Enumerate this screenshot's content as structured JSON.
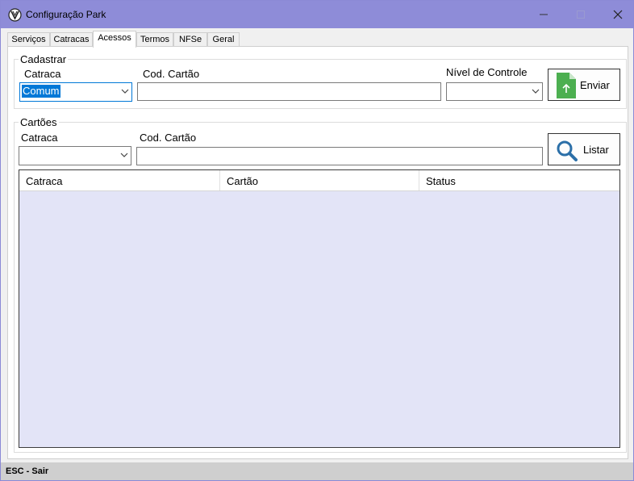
{
  "window": {
    "title": "Configuração Park"
  },
  "tabs": [
    {
      "label": "Serviços"
    },
    {
      "label": "Catracas"
    },
    {
      "label": "Acessos"
    },
    {
      "label": "Termos"
    },
    {
      "label": "NFSe"
    },
    {
      "label": "Geral"
    }
  ],
  "active_tab": "Acessos",
  "cadastrar": {
    "legend": "Cadastrar",
    "catraca_label": "Catraca",
    "catraca_value": "Comum",
    "cod_cartao_label": "Cod. Cartão",
    "cod_cartao_value": "",
    "nivel_label": "Nível de Controle",
    "nivel_value": "",
    "send_button": "Enviar"
  },
  "cartoes": {
    "legend": "Cartões",
    "catraca_label": "Catraca",
    "catraca_value": "",
    "cod_cartao_label": "Cod. Cartão",
    "cod_cartao_value": "",
    "list_button": "Listar"
  },
  "grid": {
    "columns": [
      "Catraca",
      "Cartão",
      "Status"
    ],
    "rows": []
  },
  "status_bar": {
    "text": "ESC - Sair"
  },
  "colors": {
    "titlebar": "#8e8cd8",
    "grid_background": "#e3e4f7",
    "selection": "#0078d7",
    "upload_icon": "#4caf50",
    "search_icon": "#2b6fa8"
  }
}
